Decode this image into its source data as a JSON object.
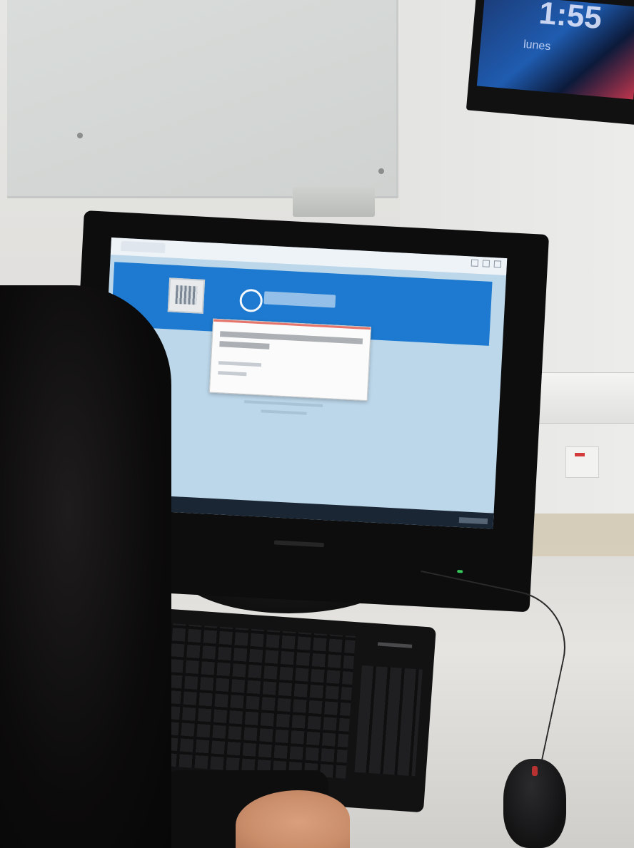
{
  "scene": {
    "description_visible_text": {
      "tv_clock": "1:55",
      "tv_date": "lunes"
    },
    "colors": {
      "site_header_blue": "#1d7ad0",
      "page_background": "#bcd7ea",
      "dialog_accent": "#e6746a",
      "power_led": "#36c85a",
      "mouse_accent": "#b83232"
    },
    "icons": [
      "crest-logo",
      "institution-logo-icon",
      "window-controls",
      "taskbar-icons"
    ]
  }
}
